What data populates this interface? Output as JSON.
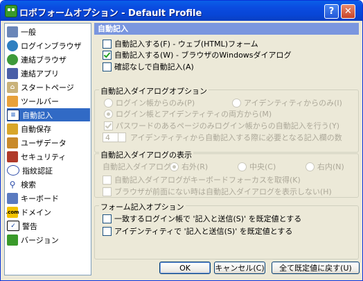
{
  "window": {
    "title": "ロボフォームオプション - Default Profile",
    "help": "?",
    "close": "✕"
  },
  "sidebar": {
    "items": [
      {
        "label": "一般",
        "icon": "computer-icon"
      },
      {
        "label": "ログインブラウザ",
        "icon": "globe-icon"
      },
      {
        "label": "連結ブラウザ",
        "icon": "linked-globe-icon"
      },
      {
        "label": "連結アプリ",
        "icon": "application-icon"
      },
      {
        "label": "スタートページ",
        "icon": "home-icon"
      },
      {
        "label": "ツールバー",
        "icon": "toolbar-icon"
      },
      {
        "label": "自動記入",
        "icon": "autofill-icon",
        "selected": true
      },
      {
        "label": "自動保存",
        "icon": "save-icon"
      },
      {
        "label": "ユーザデータ",
        "icon": "user-icon"
      },
      {
        "label": "セキュリティ",
        "icon": "security-icon"
      },
      {
        "label": "指紋認証",
        "icon": "fingerprint-icon"
      },
      {
        "label": "検索",
        "icon": "search-icon"
      },
      {
        "label": "キーボード",
        "icon": "keyboard-icon"
      },
      {
        "label": "ドメイン",
        "icon": "domain-icon"
      },
      {
        "label": "警告",
        "icon": "warning-icon"
      },
      {
        "label": "バージョン",
        "icon": "version-icon"
      }
    ]
  },
  "main": {
    "header": "自動記入",
    "top_options": [
      {
        "label": "自動記入する(F) - ウェブ(HTML)フォーム",
        "checked": false
      },
      {
        "label": "自動記入する(W) - ブラウザのWindowsダイアログ",
        "checked": true
      },
      {
        "label": "確認なしで自動記入(A)",
        "checked": false
      }
    ],
    "dialog_options": {
      "title": "自動記入ダイアログオプション",
      "radio_login_only": "ログイン帳からのみ(P)",
      "radio_identity_only": "アイデンティティからのみ(I)",
      "radio_both": "ログイン帳とアイデンティティの両方から(M)",
      "password_only": "パスワードのあるページのみログイン帳からの自動記入を行う(Y)",
      "spin_value": "4",
      "spin_label": "アイデンティティから自動記入する際に必要となる記入欄の数"
    },
    "dialog_display": {
      "title": "自動記入ダイアログの表示",
      "position_label": "自動記入ダイアログの",
      "radio_right_top": "右外(R)",
      "radio_center": "中央(C)",
      "radio_right_inside": "右内(N)",
      "keyboard_focus": "自動記入ダイアログがキーボードフォーカスを取得(K)",
      "not_foreground": "ブラウザが前面にない時は自動記入ダイアログを表示しない(H)"
    },
    "form_options": {
      "title": "フォーム記入オプション",
      "match_login": "一致するログイン帳で '記入と送信(S)' を既定値とする",
      "identity_submit": "アイデンティティで '記入と送信(S)' を既定値とする"
    }
  },
  "buttons": {
    "ok": "OK",
    "cancel": "キャンセル(C)",
    "reset": "全て既定値に戻す(U)"
  },
  "colors": {
    "title_bar": "#0a4be0",
    "selected": "#316ac5",
    "section_header": "#7a96df",
    "background": "#ece9d8"
  }
}
